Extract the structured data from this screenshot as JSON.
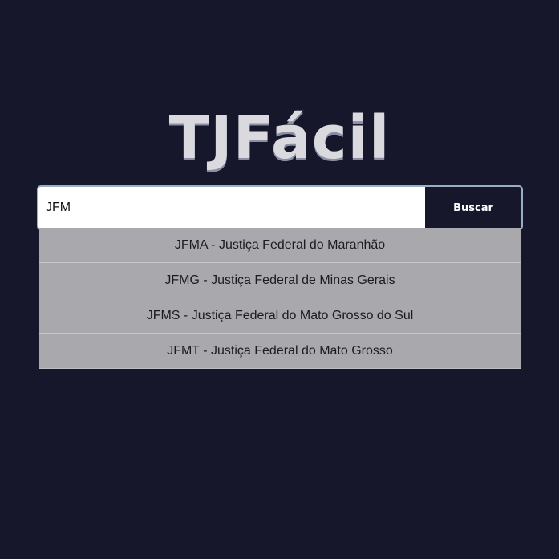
{
  "app": {
    "logo_text": "TJFácil"
  },
  "search": {
    "value": "JFM",
    "button_label": "Buscar"
  },
  "suggestions": [
    "JFMA - Justiça Federal do Maranhão",
    "JFMG - Justiça Federal de Minas Gerais",
    "JFMS - Justiça Federal do Mato Grosso do Sul",
    "JFMT - Justiça Federal do Mato Grosso"
  ],
  "colors": {
    "background": "#16172b",
    "logo": "#d9d9de",
    "input_border": "#98aec4",
    "button_background": "#16172b",
    "suggestion_background": "#a9a8ad"
  }
}
